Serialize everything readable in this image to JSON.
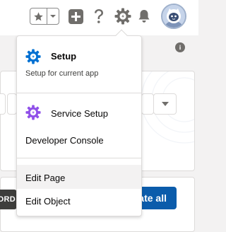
{
  "header": {
    "favorites_icon": "star-icon",
    "favorites_menu_icon": "chevron-down-icon",
    "global_actions_icon": "plus-icon",
    "help_icon": "question-icon",
    "setup_icon": "gear-icon",
    "notifications_icon": "bell-icon",
    "avatar_icon": "astro-avatar-icon"
  },
  "setup_menu": {
    "items": [
      {
        "label": "Setup",
        "sublabel": "Setup for current app",
        "icon": "setup-icon",
        "icon_color": "#0070d2"
      },
      {
        "label": "Service Setup",
        "icon": "service-setup-icon",
        "icon_color": "#9050e9"
      },
      {
        "label": "Developer Console"
      },
      {
        "label": "Edit Page",
        "highlighted": true
      },
      {
        "label": "Edit Object"
      }
    ]
  },
  "background": {
    "left_button_fragment": "ORD",
    "right_button_fragment": "ate all"
  },
  "colors": {
    "brand": "#0b5cab",
    "hover": "#f3f2f2",
    "icon_gray": "#706e6b"
  }
}
